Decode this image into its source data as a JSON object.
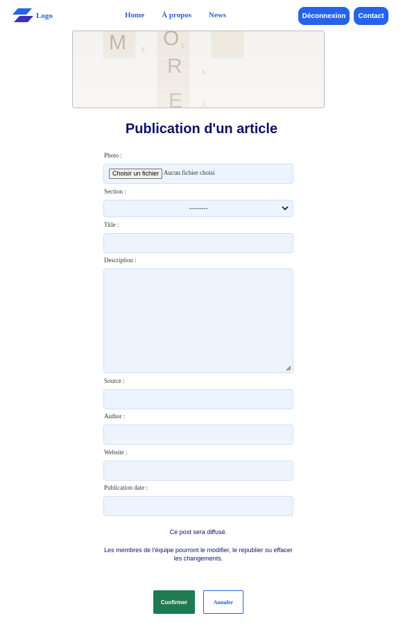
{
  "nav": {
    "logo_text": "Logo",
    "links": [
      "Home",
      "À propos",
      "News"
    ],
    "logout_label": "Déconnexion",
    "contact_label": "Contact"
  },
  "hero": {
    "tile_letters": [
      "M",
      "O",
      "R",
      "E"
    ],
    "tile_subscripts": [
      "3",
      "1",
      "1",
      "1"
    ]
  },
  "page_title": "Publication d'un article",
  "form": {
    "photo_label": "Photo :",
    "file_button_label": "Choisir un fichier",
    "file_status": "Aucun fichier choisi",
    "section_label": "Section :",
    "section_value": "---------",
    "title_label": "Title :",
    "description_label": "Description :",
    "source_label": "Source :",
    "author_label": "Author :",
    "website_label": "Website :",
    "publication_date_label": "Publication date :"
  },
  "notes": {
    "broadcast": "Ce post sera diffusé.",
    "team_info": "Les membres de l'équipe pourront le modifier, le republier ou effacer les changements."
  },
  "actions": {
    "confirm_label": "Confirmer",
    "cancel_label": "Annuler"
  },
  "colors": {
    "primary": "#2563eb",
    "title": "#0c1066",
    "confirm": "#1f7a52",
    "field_bg": "#edf4fe"
  }
}
